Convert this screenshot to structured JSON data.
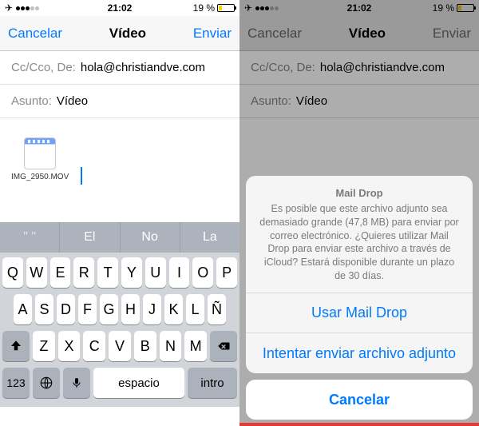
{
  "status": {
    "time": "21:02",
    "battery_pct": "19 %"
  },
  "nav": {
    "cancel": "Cancelar",
    "title": "Vídeo",
    "send": "Enviar"
  },
  "compose": {
    "cc_label": "Cc/Cco, De:",
    "from_value": "hola@christiandve.com",
    "subject_label": "Asunto:",
    "subject_value": "Vídeo",
    "attachment_name": "IMG_2950.MOV"
  },
  "predict": {
    "a": "El",
    "b": "No",
    "c": "La"
  },
  "keyboard": {
    "row1": [
      "Q",
      "W",
      "E",
      "R",
      "T",
      "Y",
      "U",
      "I",
      "O",
      "P"
    ],
    "row2": [
      "A",
      "S",
      "D",
      "F",
      "G",
      "H",
      "J",
      "K",
      "L",
      "Ñ"
    ],
    "row3": [
      "Z",
      "X",
      "C",
      "V",
      "B",
      "N",
      "M"
    ],
    "num": "123",
    "space": "espacio",
    "return": "intro"
  },
  "sheet": {
    "title": "Mail Drop",
    "message": "Es posible que este archivo adjunto sea demasiado grande (47,8 MB) para enviar por correo electrónico. ¿Quieres utilizar Mail Drop para enviar este archivo a través de iCloud? Estará disponible durante un plazo de 30 días.",
    "use": "Usar Mail Drop",
    "try": "Intentar enviar archivo adjunto",
    "cancel": "Cancelar"
  }
}
